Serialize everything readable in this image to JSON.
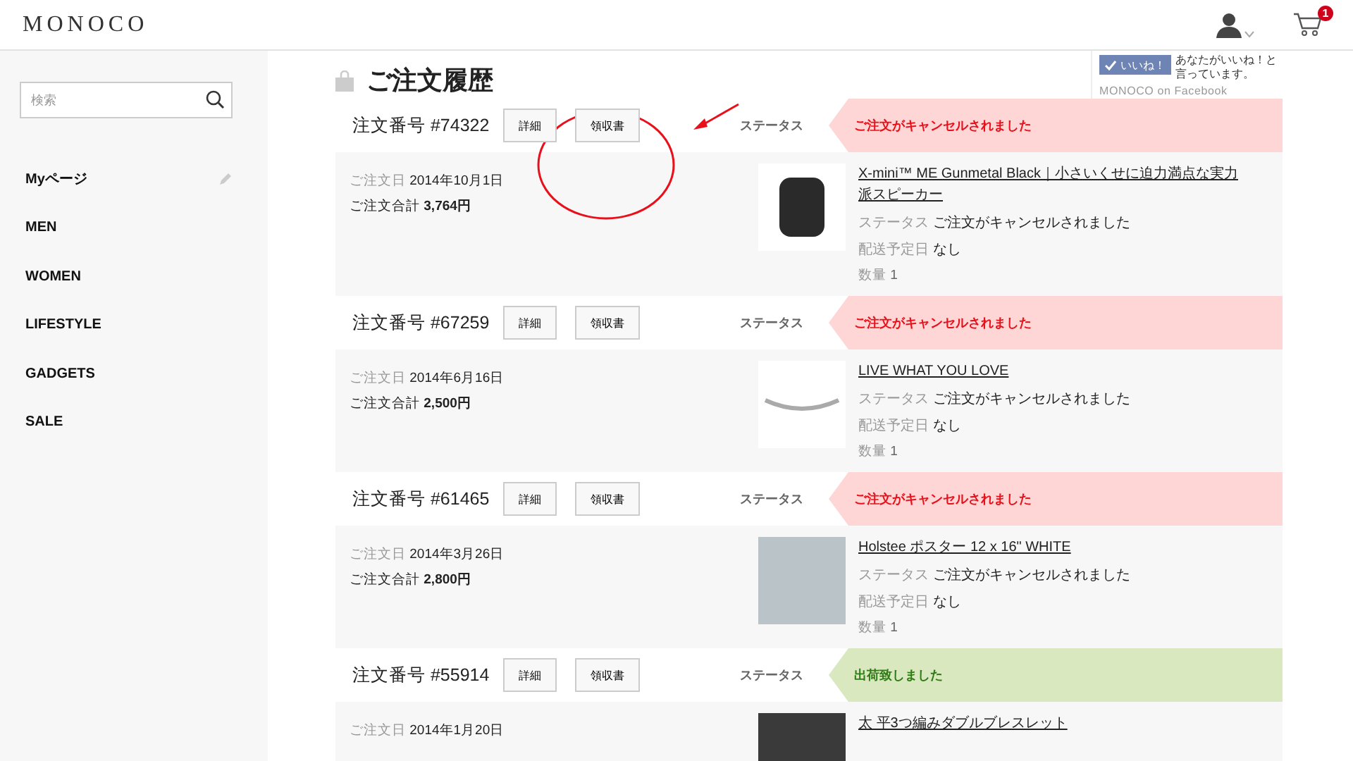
{
  "header": {
    "logo": "MONOCO",
    "cart_count": "1"
  },
  "sidebar": {
    "search": {
      "placeholder": "検索"
    },
    "items": [
      {
        "label": "Myページ",
        "editable": true
      },
      {
        "label": "MEN",
        "editable": false
      },
      {
        "label": "WOMEN",
        "editable": false
      },
      {
        "label": "LIFESTYLE",
        "editable": false
      },
      {
        "label": "GADGETS",
        "editable": false
      },
      {
        "label": "SALE",
        "editable": false
      }
    ]
  },
  "page": {
    "title": "ご注文履歴"
  },
  "facebook": {
    "like_button": "いいね！",
    "message": "あなたがいいね！と言っています。",
    "link": "MONOCO on Facebook"
  },
  "orders": [
    {
      "number": "注文番号 #74322",
      "detail_button": "詳細",
      "receipt_button": "領収書",
      "status_label": "ステータス",
      "status": "ご注文がキャンセルされました",
      "kind": "cancelled",
      "date_label": "ご注文日",
      "date": "2014年10月1日",
      "total_label": "ご注文合計",
      "total": "3,764円",
      "item": {
        "kind": "speaker",
        "title": "X-mini™ ME Gunmetal Black｜小さいくせに迫力満点な実力派スピーカー",
        "status_label": "ステータス",
        "status": "ご注文がキャンセルされました",
        "delivery_label": "配送予定日",
        "delivery": "なし",
        "quantity_label": "数量",
        "quantity": "1"
      }
    },
    {
      "number": "注文番号 #67259",
      "detail_button": "詳細",
      "receipt_button": "領収書",
      "status_label": "ステータス",
      "status": "ご注文がキャンセルされました",
      "kind": "cancelled",
      "date_label": "ご注文日",
      "date": "2014年6月16日",
      "total_label": "ご注文合計",
      "total": "2,500円",
      "item": {
        "kind": "bracelet",
        "title": "LIVE WHAT YOU LOVE",
        "status_label": "ステータス",
        "status": "ご注文がキャンセルされました",
        "delivery_label": "配送予定日",
        "delivery": "なし",
        "quantity_label": "数量",
        "quantity": "1"
      }
    },
    {
      "number": "注文番号 #61465",
      "detail_button": "詳細",
      "receipt_button": "領収書",
      "status_label": "ステータス",
      "status": "ご注文がキャンセルされました",
      "kind": "cancelled",
      "date_label": "ご注文日",
      "date": "2014年3月26日",
      "total_label": "ご注文合計",
      "total": "2,800円",
      "item": {
        "kind": "poster",
        "title": "Holstee ポスター 12 x 16\" WHITE",
        "status_label": "ステータス",
        "status": "ご注文がキャンセルされました",
        "delivery_label": "配送予定日",
        "delivery": "なし",
        "quantity_label": "数量",
        "quantity": "1"
      }
    },
    {
      "number": "注文番号 #55914",
      "detail_button": "詳細",
      "receipt_button": "領収書",
      "status_label": "ステータス",
      "status": "出荷致しました",
      "kind": "shipped",
      "date_label": "ご注文日",
      "date": "2014年1月20日",
      "item": {
        "kind": "photo",
        "title": "太 平3つ編みダブルブレスレット"
      }
    }
  ]
}
